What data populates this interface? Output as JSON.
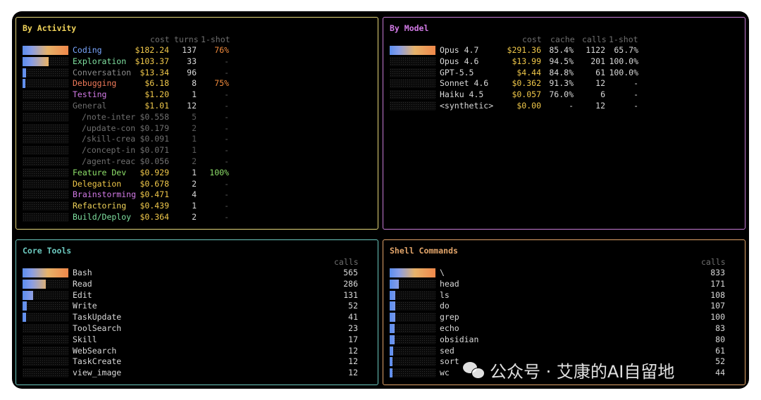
{
  "activity": {
    "title": "By Activity",
    "title_color": "#f0d35a",
    "headers": {
      "cost": "cost",
      "turns": "turns",
      "oneshot": "1-shot"
    },
    "rows": [
      {
        "name": "Coding",
        "cost": "$182.24",
        "turns": "137",
        "oneshot": "76%",
        "name_color": "#7aa7ff",
        "oneshot_color": "#f08a3c",
        "bar": 1.0
      },
      {
        "name": "Exploration",
        "cost": "$103.37",
        "turns": "33",
        "oneshot": "-",
        "name_color": "#7fe0a0",
        "oneshot_color": "#5a5a5a",
        "bar": 0.57
      },
      {
        "name": "Conversation",
        "cost": "$13.34",
        "turns": "96",
        "oneshot": "-",
        "name_color": "#8a8a8a",
        "oneshot_color": "#5a5a5a",
        "bar": 0.08
      },
      {
        "name": "Debugging",
        "cost": "$6.18",
        "turns": "8",
        "oneshot": "75%",
        "name_color": "#f07a5a",
        "oneshot_color": "#f08a3c",
        "bar": 0.04
      },
      {
        "name": "Testing",
        "cost": "$1.20",
        "turns": "1",
        "oneshot": "-",
        "name_color": "#d27ae6",
        "oneshot_color": "#5a5a5a",
        "bar": 0
      },
      {
        "name": "General",
        "cost": "$1.01",
        "turns": "12",
        "oneshot": "-",
        "name_color": "#6f6f6f",
        "oneshot_color": "#5a5a5a",
        "bar": 0
      },
      {
        "name": "/note-inter",
        "cost": "$0.558",
        "turns": "5",
        "oneshot": "-",
        "sub": true,
        "bar": 0
      },
      {
        "name": "/update-con",
        "cost": "$0.179",
        "turns": "2",
        "oneshot": "-",
        "sub": true,
        "bar": 0
      },
      {
        "name": "/skill-crea",
        "cost": "$0.091",
        "turns": "1",
        "oneshot": "-",
        "sub": true,
        "bar": 0
      },
      {
        "name": "/concept-in",
        "cost": "$0.071",
        "turns": "1",
        "oneshot": "-",
        "sub": true,
        "bar": 0
      },
      {
        "name": "/agent-reac",
        "cost": "$0.056",
        "turns": "2",
        "oneshot": "-",
        "sub": true,
        "bar": 0
      },
      {
        "name": "Feature Dev",
        "cost": "$0.929",
        "turns": "1",
        "oneshot": "100%",
        "name_color": "#8ee06a",
        "oneshot_color": "#8ee06a",
        "bar": 0
      },
      {
        "name": "Delegation",
        "cost": "$0.678",
        "turns": "2",
        "oneshot": "-",
        "name_color": "#f0c84a",
        "oneshot_color": "#5a5a5a",
        "bar": 0
      },
      {
        "name": "Brainstorming",
        "cost": "$0.471",
        "turns": "4",
        "oneshot": "-",
        "name_color": "#d27ae6",
        "oneshot_color": "#5a5a5a",
        "bar": 0
      },
      {
        "name": "Refactoring",
        "cost": "$0.439",
        "turns": "1",
        "oneshot": "-",
        "name_color": "#f0d35a",
        "oneshot_color": "#5a5a5a",
        "bar": 0
      },
      {
        "name": "Build/Deploy",
        "cost": "$0.364",
        "turns": "2",
        "oneshot": "-",
        "name_color": "#7fe0a0",
        "oneshot_color": "#5a5a5a",
        "bar": 0
      }
    ]
  },
  "model": {
    "title": "By Model",
    "title_color": "#d27ae6",
    "headers": {
      "cost": "cost",
      "cache": "cache",
      "calls": "calls",
      "oneshot": "1-shot"
    },
    "rows": [
      {
        "name": "Opus 4.7",
        "cost": "$291.36",
        "cache": "85.4%",
        "calls": "1122",
        "oneshot": "65.7%",
        "bar": 1.0
      },
      {
        "name": "Opus 4.6",
        "cost": "$13.99",
        "cache": "94.5%",
        "calls": "201",
        "oneshot": "100.0%",
        "bar": 0
      },
      {
        "name": "GPT-5.5",
        "cost": "$4.44",
        "cache": "84.8%",
        "calls": "61",
        "oneshot": "100.0%",
        "bar": 0
      },
      {
        "name": "Sonnet 4.6",
        "cost": "$0.362",
        "cache": "91.3%",
        "calls": "12",
        "oneshot": "-",
        "bar": 0
      },
      {
        "name": "Haiku 4.5",
        "cost": "$0.057",
        "cache": "76.0%",
        "calls": "6",
        "oneshot": "-",
        "bar": 0
      },
      {
        "name": "<synthetic>",
        "cost": "$0.00",
        "cache": "-",
        "calls": "12",
        "oneshot": "-",
        "bar": 0
      }
    ]
  },
  "tools": {
    "title": "Core Tools",
    "title_color": "#6cc9bf",
    "headers": {
      "calls": "calls"
    },
    "rows": [
      {
        "name": "Bash",
        "calls": "565",
        "bar": 1.0
      },
      {
        "name": "Read",
        "calls": "286",
        "bar": 0.51
      },
      {
        "name": "Edit",
        "calls": "131",
        "bar": 0.23
      },
      {
        "name": "Write",
        "calls": "52",
        "bar": 0.09
      },
      {
        "name": "TaskUpdate",
        "calls": "41",
        "bar": 0.07
      },
      {
        "name": "ToolSearch",
        "calls": "23",
        "bar": 0
      },
      {
        "name": "Skill",
        "calls": "17",
        "bar": 0
      },
      {
        "name": "WebSearch",
        "calls": "12",
        "bar": 0
      },
      {
        "name": "TaskCreate",
        "calls": "12",
        "bar": 0
      },
      {
        "name": "view_image",
        "calls": "12",
        "bar": 0
      }
    ]
  },
  "shell": {
    "title": "Shell Commands",
    "title_color": "#e3a56a",
    "headers": {
      "calls": "calls"
    },
    "rows": [
      {
        "name": "\\",
        "calls": "833",
        "bar": 1.0
      },
      {
        "name": "head",
        "calls": "171",
        "bar": 0.2
      },
      {
        "name": "ls",
        "calls": "108",
        "bar": 0.13
      },
      {
        "name": "do",
        "calls": "107",
        "bar": 0.13
      },
      {
        "name": "grep",
        "calls": "100",
        "bar": 0.12
      },
      {
        "name": "echo",
        "calls": "83",
        "bar": 0.1
      },
      {
        "name": "obsidian",
        "calls": "80",
        "bar": 0.1
      },
      {
        "name": "sed",
        "calls": "61",
        "bar": 0.07
      },
      {
        "name": "sort",
        "calls": "52",
        "bar": 0.06
      },
      {
        "name": "wc",
        "calls": "44",
        "bar": 0.05
      }
    ]
  },
  "watermark": {
    "text": "公众号 · 艾康的AI自留地"
  }
}
